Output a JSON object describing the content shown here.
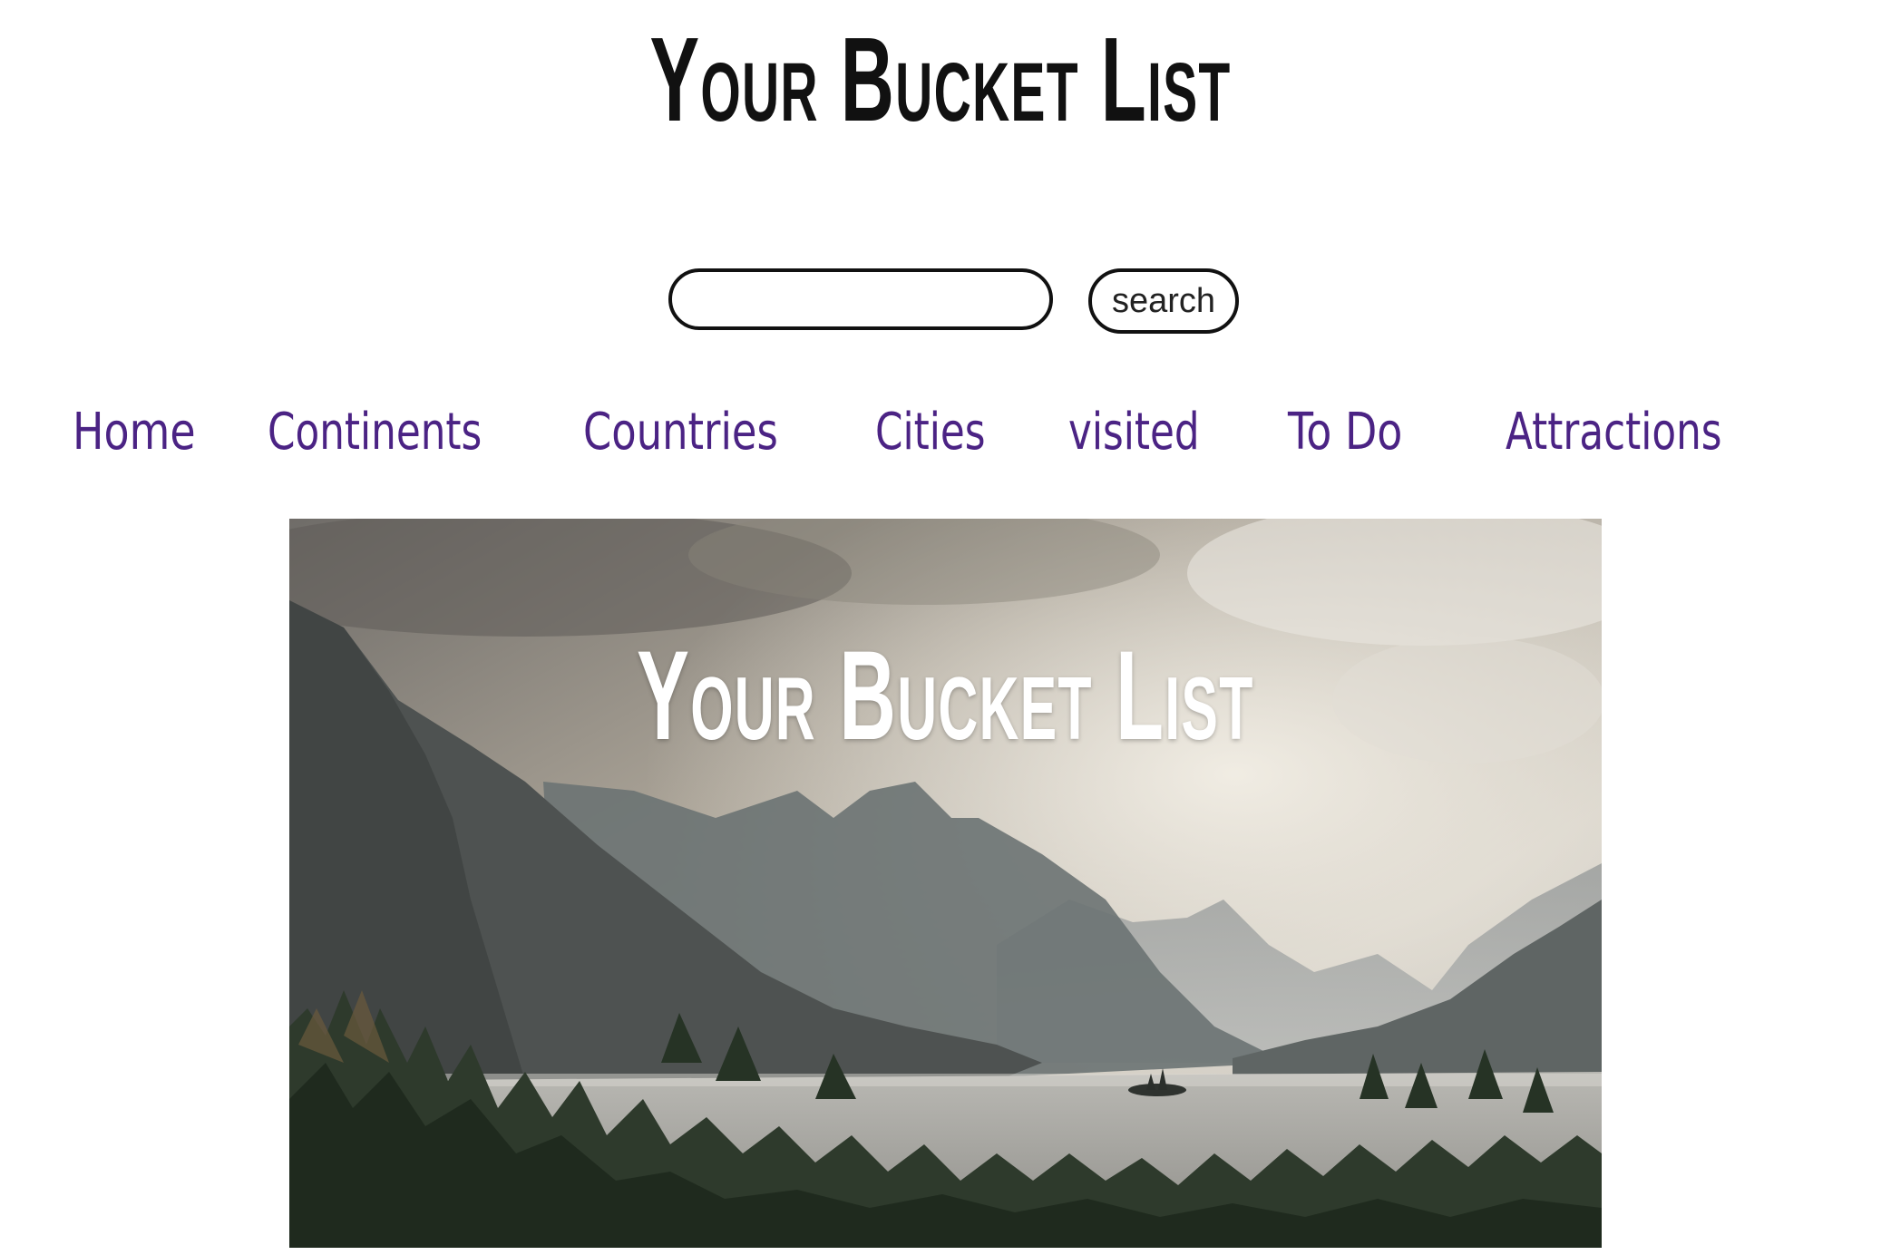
{
  "header": {
    "title": "Your Bucket List"
  },
  "search": {
    "placeholder": "",
    "value": "",
    "button_label": "search"
  },
  "nav": {
    "items": [
      {
        "label": "Home"
      },
      {
        "label": "Continents"
      },
      {
        "label": "Countries"
      },
      {
        "label": "Cities"
      },
      {
        "label": "visited"
      },
      {
        "label": "To Do"
      },
      {
        "label": "Attractions"
      }
    ]
  },
  "hero": {
    "title": "Your Bucket List",
    "image_subject": "mountain-lake-landscape"
  },
  "colors": {
    "nav_link": "#4b2384",
    "title": "#111111",
    "hero_title": "#ffffff"
  }
}
